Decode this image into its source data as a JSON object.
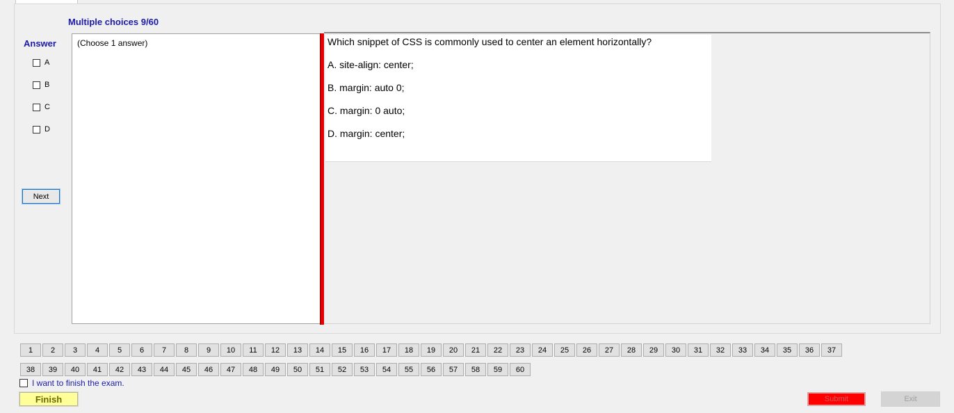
{
  "header": {
    "title": "Multiple choices 9/60"
  },
  "answer": {
    "label": "Answer",
    "options": [
      {
        "letter": "A",
        "checked": false
      },
      {
        "letter": "B",
        "checked": false
      },
      {
        "letter": "C",
        "checked": false
      },
      {
        "letter": "D",
        "checked": false
      }
    ],
    "next_label": "Next"
  },
  "instruction": "(Choose 1 answer)",
  "question": {
    "text": "Which snippet of CSS is commonly used to center an element horizontally?",
    "choices": [
      "A.  site-align: center;",
      "B.  margin: auto 0;",
      "C.  margin: 0 auto;",
      "D.  margin: center;"
    ]
  },
  "navigator": {
    "row1": [
      "1",
      "2",
      "3",
      "4",
      "5",
      "6",
      "7",
      "8",
      "9",
      "10",
      "11",
      "12",
      "13",
      "14",
      "15",
      "16",
      "17",
      "18",
      "19",
      "20",
      "21",
      "22",
      "23",
      "24",
      "25",
      "26",
      "27",
      "28",
      "29",
      "30",
      "31",
      "32",
      "33",
      "34",
      "35",
      "36",
      "37"
    ],
    "row2": [
      "38",
      "39",
      "40",
      "41",
      "42",
      "43",
      "44",
      "45",
      "46",
      "47",
      "48",
      "49",
      "50",
      "51",
      "52",
      "53",
      "54",
      "55",
      "56",
      "57",
      "58",
      "59",
      "60"
    ]
  },
  "footer": {
    "finish_checkbox_label": "I want to finish the exam.",
    "finish_label": "Finish",
    "submit_label": "Submit",
    "exit_label": "Exit"
  },
  "colors": {
    "accent_blue": "#1b1baa",
    "splitter_red": "#e60000",
    "finish_yellow": "#ffff99",
    "submit_red": "#ff0000"
  }
}
